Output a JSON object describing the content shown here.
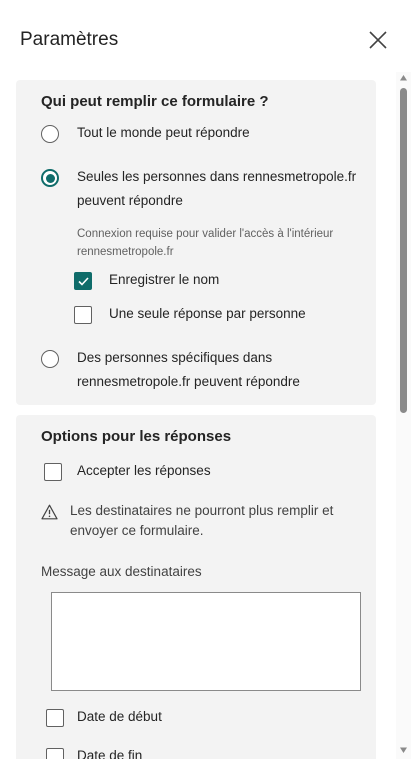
{
  "panel": {
    "title": "Paramètres",
    "close_icon": "close-icon"
  },
  "who_can_fill": {
    "title": "Qui peut remplir ce formulaire ?",
    "options": [
      {
        "label": "Tout le monde peut répondre",
        "selected": false
      },
      {
        "label": "Seules les personnes dans rennesmetropole.fr peuvent répondre",
        "selected": true
      },
      {
        "label": "Des personnes spécifiques dans rennesmetropole.fr peuvent répondre",
        "selected": false
      }
    ],
    "hint": "Connexion requise pour valider l'accès à l'intérieur rennesmetropole.fr",
    "sub_options": [
      {
        "label": "Enregistrer le nom",
        "checked": true
      },
      {
        "label": "Une seule réponse par personne",
        "checked": false
      }
    ]
  },
  "response_options": {
    "title": "Options pour les réponses",
    "accept_label": "Accepter les réponses",
    "accept_checked": false,
    "warning_icon": "warning-icon",
    "warning_text": "Les destinataires ne pourront plus remplir et envoyer ce formulaire.",
    "message_label": "Message aux destinataires",
    "message_value": "",
    "start_date_label": "Date de début",
    "end_date_label": "Date de fin"
  },
  "colors": {
    "accent": "#0f6c6a",
    "card_bg": "#f3f3f3"
  }
}
